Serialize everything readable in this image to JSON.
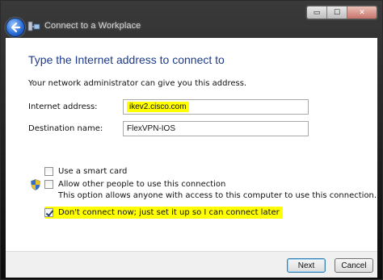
{
  "window": {
    "title": "Connect to a Workplace",
    "caption_buttons": {
      "minimize": "▭",
      "maximize": "☐",
      "close": "✕"
    }
  },
  "page": {
    "heading": "Type the Internet address to connect to",
    "instruction": "Your network administrator can give you this address.",
    "internet_address": {
      "label": "Internet address:",
      "value": "ikev2.cisco.com"
    },
    "destination_name": {
      "label": "Destination name:",
      "value": "FlexVPN-IOS"
    },
    "options": {
      "smart_card": {
        "label": "Use a smart card",
        "checked": false
      },
      "allow_others": {
        "label": "Allow other people to use this connection",
        "checked": false,
        "note": "This option allows anyone with access to this computer to use this connection."
      },
      "dont_connect": {
        "label": "Don't connect now; just set it up so I can connect later",
        "checked": true
      }
    }
  },
  "footer": {
    "next_label": "Next",
    "cancel_label": "Cancel"
  },
  "icons": {
    "back": "back-arrow-icon",
    "app": "network-icon",
    "shield": "uac-shield-icon"
  },
  "colors": {
    "heading": "#1e3b8a",
    "highlight": "#ffff00"
  }
}
